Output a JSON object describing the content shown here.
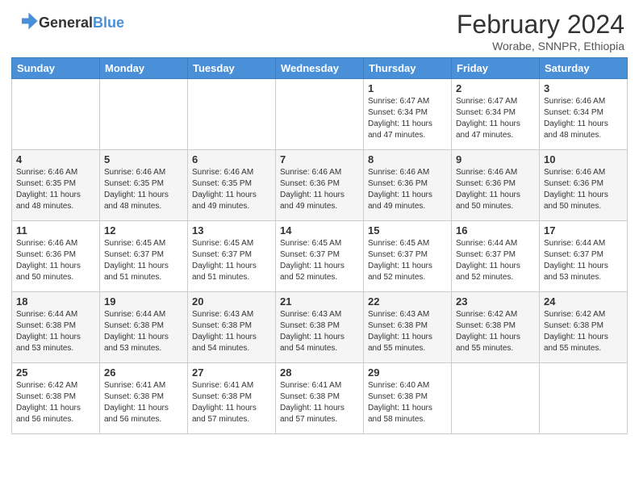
{
  "header": {
    "logo_line1": "General",
    "logo_line2": "Blue",
    "month": "February 2024",
    "location": "Worabe, SNNPR, Ethiopia"
  },
  "days_of_week": [
    "Sunday",
    "Monday",
    "Tuesday",
    "Wednesday",
    "Thursday",
    "Friday",
    "Saturday"
  ],
  "weeks": [
    [
      {
        "day": "",
        "info": ""
      },
      {
        "day": "",
        "info": ""
      },
      {
        "day": "",
        "info": ""
      },
      {
        "day": "",
        "info": ""
      },
      {
        "day": "1",
        "info": "Sunrise: 6:47 AM\nSunset: 6:34 PM\nDaylight: 11 hours\nand 47 minutes."
      },
      {
        "day": "2",
        "info": "Sunrise: 6:47 AM\nSunset: 6:34 PM\nDaylight: 11 hours\nand 47 minutes."
      },
      {
        "day": "3",
        "info": "Sunrise: 6:46 AM\nSunset: 6:34 PM\nDaylight: 11 hours\nand 48 minutes."
      }
    ],
    [
      {
        "day": "4",
        "info": "Sunrise: 6:46 AM\nSunset: 6:35 PM\nDaylight: 11 hours\nand 48 minutes."
      },
      {
        "day": "5",
        "info": "Sunrise: 6:46 AM\nSunset: 6:35 PM\nDaylight: 11 hours\nand 48 minutes."
      },
      {
        "day": "6",
        "info": "Sunrise: 6:46 AM\nSunset: 6:35 PM\nDaylight: 11 hours\nand 49 minutes."
      },
      {
        "day": "7",
        "info": "Sunrise: 6:46 AM\nSunset: 6:36 PM\nDaylight: 11 hours\nand 49 minutes."
      },
      {
        "day": "8",
        "info": "Sunrise: 6:46 AM\nSunset: 6:36 PM\nDaylight: 11 hours\nand 49 minutes."
      },
      {
        "day": "9",
        "info": "Sunrise: 6:46 AM\nSunset: 6:36 PM\nDaylight: 11 hours\nand 50 minutes."
      },
      {
        "day": "10",
        "info": "Sunrise: 6:46 AM\nSunset: 6:36 PM\nDaylight: 11 hours\nand 50 minutes."
      }
    ],
    [
      {
        "day": "11",
        "info": "Sunrise: 6:46 AM\nSunset: 6:36 PM\nDaylight: 11 hours\nand 50 minutes."
      },
      {
        "day": "12",
        "info": "Sunrise: 6:45 AM\nSunset: 6:37 PM\nDaylight: 11 hours\nand 51 minutes."
      },
      {
        "day": "13",
        "info": "Sunrise: 6:45 AM\nSunset: 6:37 PM\nDaylight: 11 hours\nand 51 minutes."
      },
      {
        "day": "14",
        "info": "Sunrise: 6:45 AM\nSunset: 6:37 PM\nDaylight: 11 hours\nand 52 minutes."
      },
      {
        "day": "15",
        "info": "Sunrise: 6:45 AM\nSunset: 6:37 PM\nDaylight: 11 hours\nand 52 minutes."
      },
      {
        "day": "16",
        "info": "Sunrise: 6:44 AM\nSunset: 6:37 PM\nDaylight: 11 hours\nand 52 minutes."
      },
      {
        "day": "17",
        "info": "Sunrise: 6:44 AM\nSunset: 6:37 PM\nDaylight: 11 hours\nand 53 minutes."
      }
    ],
    [
      {
        "day": "18",
        "info": "Sunrise: 6:44 AM\nSunset: 6:38 PM\nDaylight: 11 hours\nand 53 minutes."
      },
      {
        "day": "19",
        "info": "Sunrise: 6:44 AM\nSunset: 6:38 PM\nDaylight: 11 hours\nand 53 minutes."
      },
      {
        "day": "20",
        "info": "Sunrise: 6:43 AM\nSunset: 6:38 PM\nDaylight: 11 hours\nand 54 minutes."
      },
      {
        "day": "21",
        "info": "Sunrise: 6:43 AM\nSunset: 6:38 PM\nDaylight: 11 hours\nand 54 minutes."
      },
      {
        "day": "22",
        "info": "Sunrise: 6:43 AM\nSunset: 6:38 PM\nDaylight: 11 hours\nand 55 minutes."
      },
      {
        "day": "23",
        "info": "Sunrise: 6:42 AM\nSunset: 6:38 PM\nDaylight: 11 hours\nand 55 minutes."
      },
      {
        "day": "24",
        "info": "Sunrise: 6:42 AM\nSunset: 6:38 PM\nDaylight: 11 hours\nand 55 minutes."
      }
    ],
    [
      {
        "day": "25",
        "info": "Sunrise: 6:42 AM\nSunset: 6:38 PM\nDaylight: 11 hours\nand 56 minutes."
      },
      {
        "day": "26",
        "info": "Sunrise: 6:41 AM\nSunset: 6:38 PM\nDaylight: 11 hours\nand 56 minutes."
      },
      {
        "day": "27",
        "info": "Sunrise: 6:41 AM\nSunset: 6:38 PM\nDaylight: 11 hours\nand 57 minutes."
      },
      {
        "day": "28",
        "info": "Sunrise: 6:41 AM\nSunset: 6:38 PM\nDaylight: 11 hours\nand 57 minutes."
      },
      {
        "day": "29",
        "info": "Sunrise: 6:40 AM\nSunset: 6:38 PM\nDaylight: 11 hours\nand 58 minutes."
      },
      {
        "day": "",
        "info": ""
      },
      {
        "day": "",
        "info": ""
      }
    ]
  ]
}
